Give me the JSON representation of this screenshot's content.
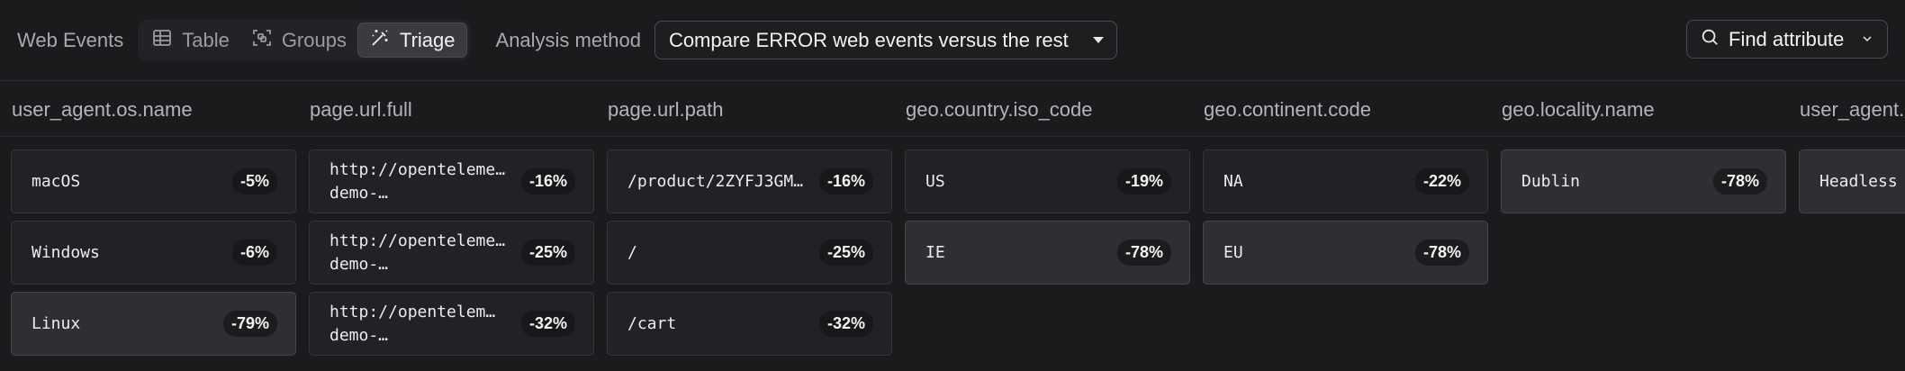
{
  "toolbar": {
    "title": "Web Events",
    "tabs": [
      {
        "label": "Table",
        "icon": "table-icon"
      },
      {
        "label": "Groups",
        "icon": "groups-icon"
      },
      {
        "label": "Triage",
        "icon": "magic-wand-icon",
        "active": true
      }
    ],
    "method_label": "Analysis method",
    "method_value": "Compare ERROR web events versus the rest",
    "find_attribute": "Find attribute"
  },
  "columns": [
    {
      "header": "user_agent.os.name",
      "cells": [
        {
          "value": "macOS",
          "pct": "-5%"
        },
        {
          "value": "Windows",
          "pct": "-6%"
        },
        {
          "value": "Linux",
          "pct": "-79%",
          "strong": true
        }
      ]
    },
    {
      "header": "page.url.full",
      "cells": [
        {
          "line1": "http://openteleme…",
          "line2": "demo-…",
          "pct": "-16%"
        },
        {
          "line1": "http://openteleme…",
          "line2": "demo-…",
          "pct": "-25%"
        },
        {
          "line1": "http://opentelem…",
          "line2": "demo-…",
          "pct": "-32%"
        }
      ]
    },
    {
      "header": "page.url.path",
      "cells": [
        {
          "value": "/product/2ZYFJ3GM…",
          "pct": "-16%"
        },
        {
          "value": "/",
          "pct": "-25%"
        },
        {
          "value": "/cart",
          "pct": "-32%"
        }
      ]
    },
    {
      "header": "geo.country.iso_code",
      "cells": [
        {
          "value": "US",
          "pct": "-19%"
        },
        {
          "value": "IE",
          "pct": "-78%",
          "strong": true
        }
      ]
    },
    {
      "header": "geo.continent.code",
      "cells": [
        {
          "value": "NA",
          "pct": "-22%"
        },
        {
          "value": "EU",
          "pct": "-78%",
          "strong": true
        }
      ]
    },
    {
      "header": "geo.locality.name",
      "cells": [
        {
          "value": "Dublin",
          "pct": "-78%",
          "strong": true
        }
      ]
    },
    {
      "header": "user_agent.",
      "cells": [
        {
          "value": "Headless",
          "pct": ""
        }
      ]
    }
  ]
}
